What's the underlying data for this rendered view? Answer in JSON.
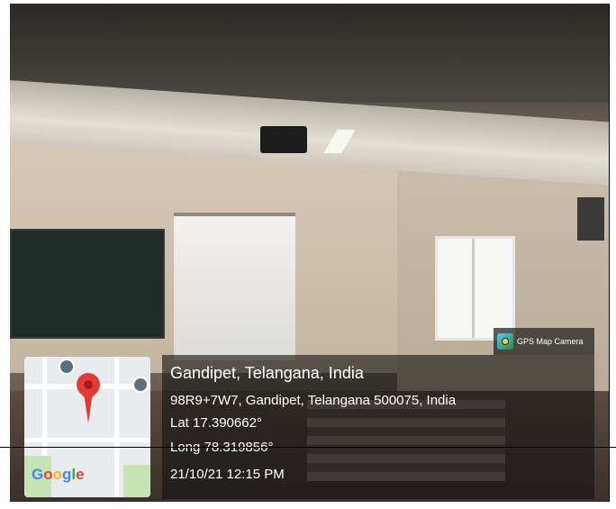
{
  "camera_badge": {
    "label": "GPS Map Camera",
    "icon": "gps-map-camera-app-icon"
  },
  "location": {
    "place": "Gandipet, Telangana, India",
    "address": "98R9+7W7, Gandipet, Telangana 500075, India",
    "lat": "Lat 17.390662°",
    "long": "Long 78.319856°",
    "datetime": "21/10/21 12:15 PM"
  },
  "map": {
    "brand_letters": [
      "G",
      "o",
      "o",
      "g",
      "l",
      "e"
    ],
    "brand_colors": [
      "#4285F4",
      "#EA4335",
      "#FBBC05",
      "#4285F4",
      "#34A853",
      "#EA4335"
    ],
    "pin_icon": "map-pin-icon",
    "pin_color": "#E53935"
  }
}
